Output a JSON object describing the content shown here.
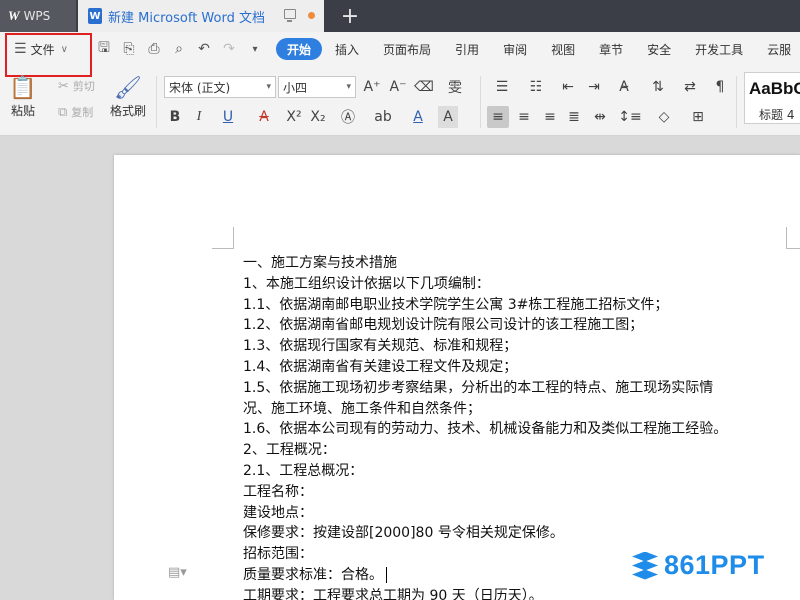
{
  "tabs": {
    "app_label": "WPS",
    "doc_label": "新建 Microsoft Word 文档",
    "new_tab": "+"
  },
  "menu": {
    "file_label": "文件",
    "tabs": [
      "开始",
      "插入",
      "页面布局",
      "引用",
      "审阅",
      "视图",
      "章节",
      "安全",
      "开发工具",
      "云服"
    ],
    "active_tab": "开始"
  },
  "toolbar": {
    "paste_label": "粘贴",
    "cut_label": "剪切",
    "copy_label": "复制",
    "format_painter_label": "格式刷",
    "font_name": "宋体 (正文)",
    "font_size": "小四",
    "style_sample": "AaBbC",
    "style_name": "标题 4"
  },
  "document": {
    "lines": [
      "一、施工方案与技术措施",
      "1、本施工组织设计依据以下几项编制：",
      "1.1、依据湖南邮电职业技术学院学生公寓 3#栋工程施工招标文件；",
      "1.2、依据湖南省邮电规划设计院有限公司设计的该工程施工图；",
      "1.3、依据现行国家有关规范、标准和规程；",
      "1.4、依据湖南省有关建设工程文件及规定；",
      "1.5、依据施工现场初步考察结果，分析出的本工程的特点、施工现场实际情",
      "况、施工环境、施工条件和自然条件；",
      "1.6、依据本公司现有的劳动力、技术、机械设备能力和及类似工程施工经验。",
      "2、工程概况：",
      "2.1、工程总概况：",
      "工程名称：",
      "建设地点：",
      "保修要求：按建设部[2000]80 号令相关规定保修。",
      "招标范围：",
      "质量要求标准：合格。",
      "工期要求：工程要求总工期为 90 天（日历天）。"
    ]
  },
  "watermark": {
    "text": "861PPT"
  },
  "colors": {
    "accent": "#2f7fe0",
    "highlight": "#e02020",
    "tabbar": "#3b3e46"
  }
}
